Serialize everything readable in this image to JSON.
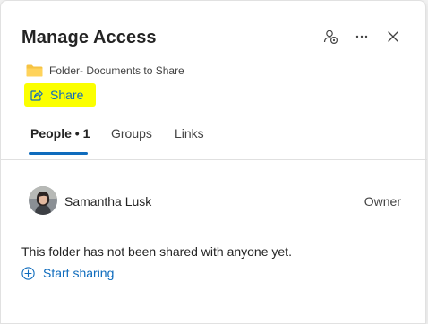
{
  "dialog": {
    "title": "Manage Access",
    "folder_name": "Folder- Documents to Share",
    "share_label": "Share"
  },
  "header_actions": [
    {
      "icon": "add-person-icon"
    },
    {
      "icon": "more-options-icon"
    },
    {
      "icon": "close-icon"
    }
  ],
  "tabs": [
    {
      "label": "People • 1",
      "active": true
    },
    {
      "label": "Groups",
      "active": false
    },
    {
      "label": "Links",
      "active": false
    }
  ],
  "people": [
    {
      "name": "Samantha Lusk",
      "role": "Owner"
    }
  ],
  "empty_message": "This folder has not been shared with anyone yet.",
  "start_sharing_label": "Start sharing",
  "colors": {
    "accent": "#0f6cbd",
    "highlight": "#fbff00",
    "folder": "#f6c343"
  }
}
